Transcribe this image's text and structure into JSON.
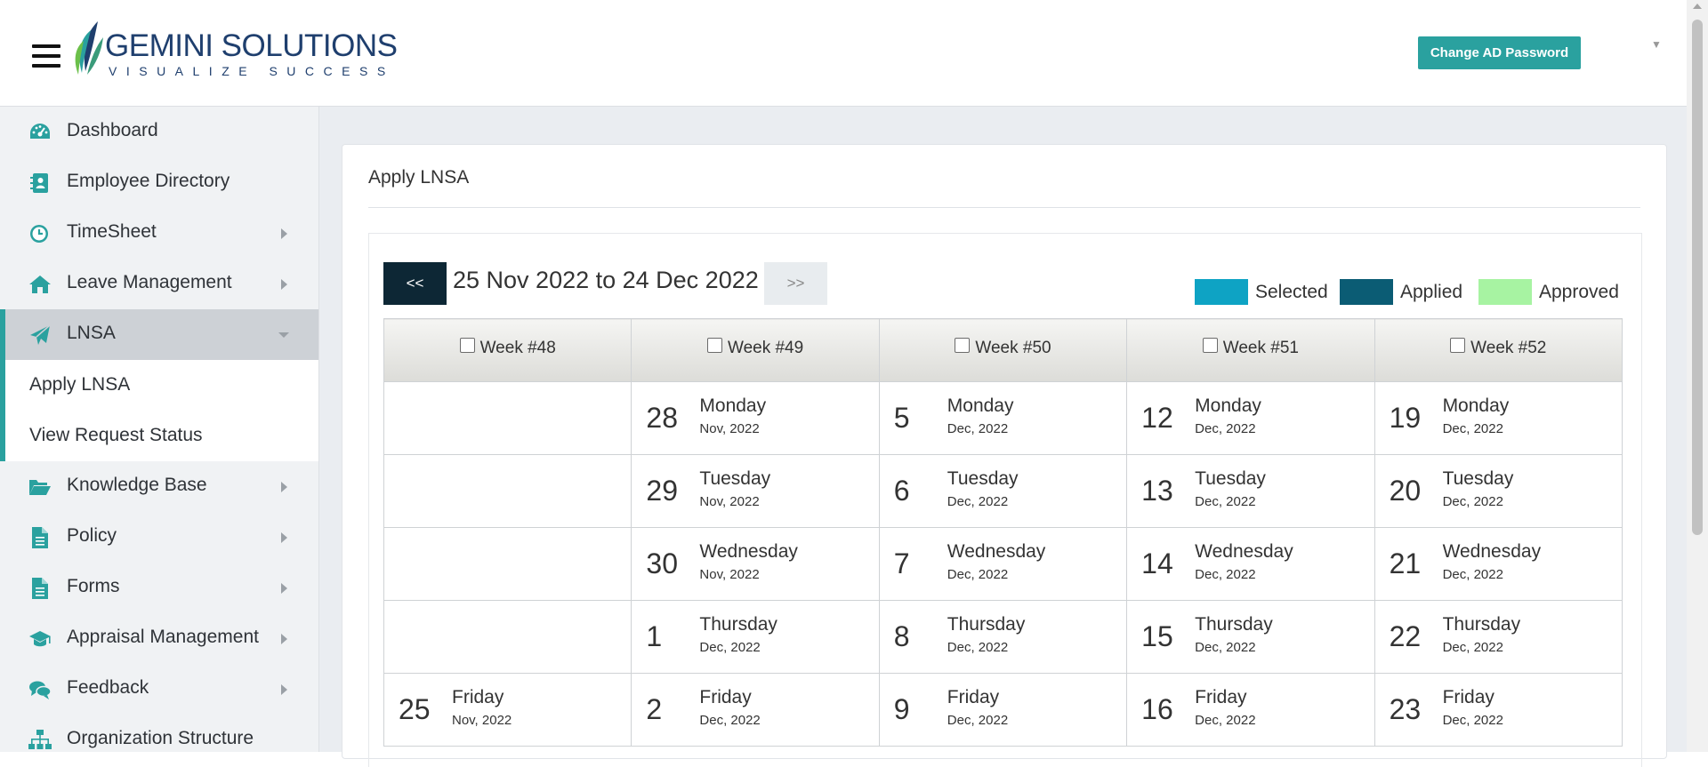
{
  "header": {
    "logo_name_1": "GEMINI",
    "logo_name_2": " SOLUTIONS",
    "logo_tagline": "VISUALIZE SUCCESS",
    "change_password_label": "Change AD Password"
  },
  "sidebar": {
    "items": [
      {
        "label": "Dashboard",
        "icon": "dashboard-icon"
      },
      {
        "label": "Employee Directory",
        "icon": "contacts-icon"
      },
      {
        "label": "TimeSheet",
        "icon": "clock-icon"
      },
      {
        "label": "Leave Management",
        "icon": "home-icon"
      },
      {
        "label": "LNSA",
        "icon": "paper-plane-icon"
      },
      {
        "label": "Knowledge Base",
        "icon": "folder-open-icon"
      },
      {
        "label": "Policy",
        "icon": "document-icon"
      },
      {
        "label": "Forms",
        "icon": "document-icon"
      },
      {
        "label": "Appraisal Management",
        "icon": "graduation-cap-icon"
      },
      {
        "label": "Feedback",
        "icon": "comments-icon"
      },
      {
        "label": "Organization Structure",
        "icon": "sitemap-icon"
      }
    ],
    "lnsa_sub": [
      "Apply LNSA",
      "View Request Status"
    ],
    "accent_color": "#2aa19f"
  },
  "page": {
    "title": "Apply LNSA",
    "prev_label": "<<",
    "next_label": ">>",
    "date_range": "25 Nov 2022 to 24 Dec 2022"
  },
  "legend": [
    {
      "label": "Selected",
      "color": "#0ea3c4"
    },
    {
      "label": "Applied",
      "color": "#0b5c74"
    },
    {
      "label": "Approved",
      "color": "#a7f3a2"
    }
  ],
  "calendar": {
    "weeks": [
      "Week #48",
      "Week #49",
      "Week #50",
      "Week #51",
      "Week #52"
    ],
    "rows": [
      [
        null,
        {
          "day": "28",
          "name": "Monday",
          "month": "Nov, 2022"
        },
        {
          "day": "5",
          "name": "Monday",
          "month": "Dec, 2022"
        },
        {
          "day": "12",
          "name": "Monday",
          "month": "Dec, 2022"
        },
        {
          "day": "19",
          "name": "Monday",
          "month": "Dec, 2022"
        }
      ],
      [
        null,
        {
          "day": "29",
          "name": "Tuesday",
          "month": "Nov, 2022"
        },
        {
          "day": "6",
          "name": "Tuesday",
          "month": "Dec, 2022"
        },
        {
          "day": "13",
          "name": "Tuesday",
          "month": "Dec, 2022"
        },
        {
          "day": "20",
          "name": "Tuesday",
          "month": "Dec, 2022"
        }
      ],
      [
        null,
        {
          "day": "30",
          "name": "Wednesday",
          "month": "Nov, 2022"
        },
        {
          "day": "7",
          "name": "Wednesday",
          "month": "Dec, 2022"
        },
        {
          "day": "14",
          "name": "Wednesday",
          "month": "Dec, 2022"
        },
        {
          "day": "21",
          "name": "Wednesday",
          "month": "Dec, 2022"
        }
      ],
      [
        null,
        {
          "day": "1",
          "name": "Thursday",
          "month": "Dec, 2022"
        },
        {
          "day": "8",
          "name": "Thursday",
          "month": "Dec, 2022"
        },
        {
          "day": "15",
          "name": "Thursday",
          "month": "Dec, 2022"
        },
        {
          "day": "22",
          "name": "Thursday",
          "month": "Dec, 2022"
        }
      ],
      [
        {
          "day": "25",
          "name": "Friday",
          "month": "Nov, 2022"
        },
        {
          "day": "2",
          "name": "Friday",
          "month": "Dec, 2022"
        },
        {
          "day": "9",
          "name": "Friday",
          "month": "Dec, 2022"
        },
        {
          "day": "16",
          "name": "Friday",
          "month": "Dec, 2022"
        },
        {
          "day": "23",
          "name": "Friday",
          "month": "Dec, 2022"
        }
      ]
    ]
  }
}
